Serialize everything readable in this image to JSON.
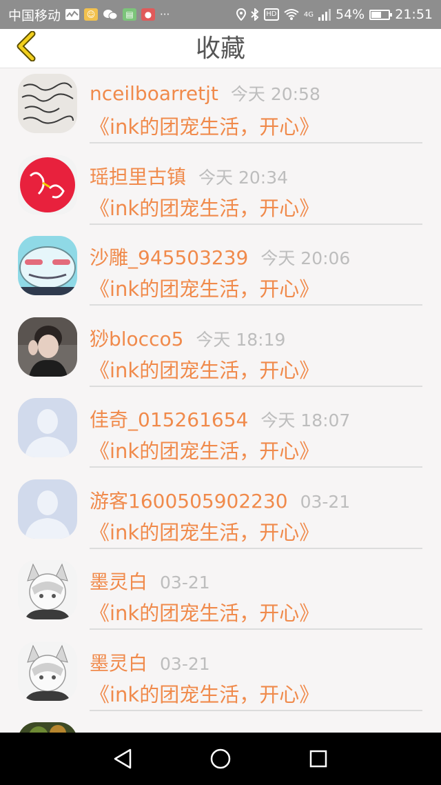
{
  "status_bar": {
    "carrier": "中国移动",
    "network": "4G",
    "battery": "54%",
    "battery_level": 0.54,
    "time": "21:51"
  },
  "header": {
    "title": "收藏"
  },
  "favorites": [
    {
      "username": "nceilboarretjt",
      "time": "今天 20:58",
      "title": "《ink的团宠生活，开心》"
    },
    {
      "username": "瑶担里古镇",
      "time": "今天 20:34",
      "title": "《ink的团宠生活，开心》"
    },
    {
      "username": "沙雕_945503239",
      "time": "今天 20:06",
      "title": "《ink的团宠生活，开心》"
    },
    {
      "username": "猀blocco5",
      "time": "今天 18:19",
      "title": "《ink的团宠生活，开心》"
    },
    {
      "username": "佳奇_015261654",
      "time": "今天 18:07",
      "title": "《ink的团宠生活，开心》"
    },
    {
      "username": "游客1600505902230",
      "time": "03-21",
      "title": "《ink的团宠生活，开心》"
    },
    {
      "username": "墨灵白",
      "time": "03-21",
      "title": "《ink的团宠生活，开心》"
    },
    {
      "username": "墨灵白",
      "time": "03-21",
      "title": "《ink的团宠生活，开心》"
    }
  ],
  "colors": {
    "accent": "#f08a4b",
    "time_text": "#bdbdbd",
    "back_arrow": "#e6c200"
  }
}
